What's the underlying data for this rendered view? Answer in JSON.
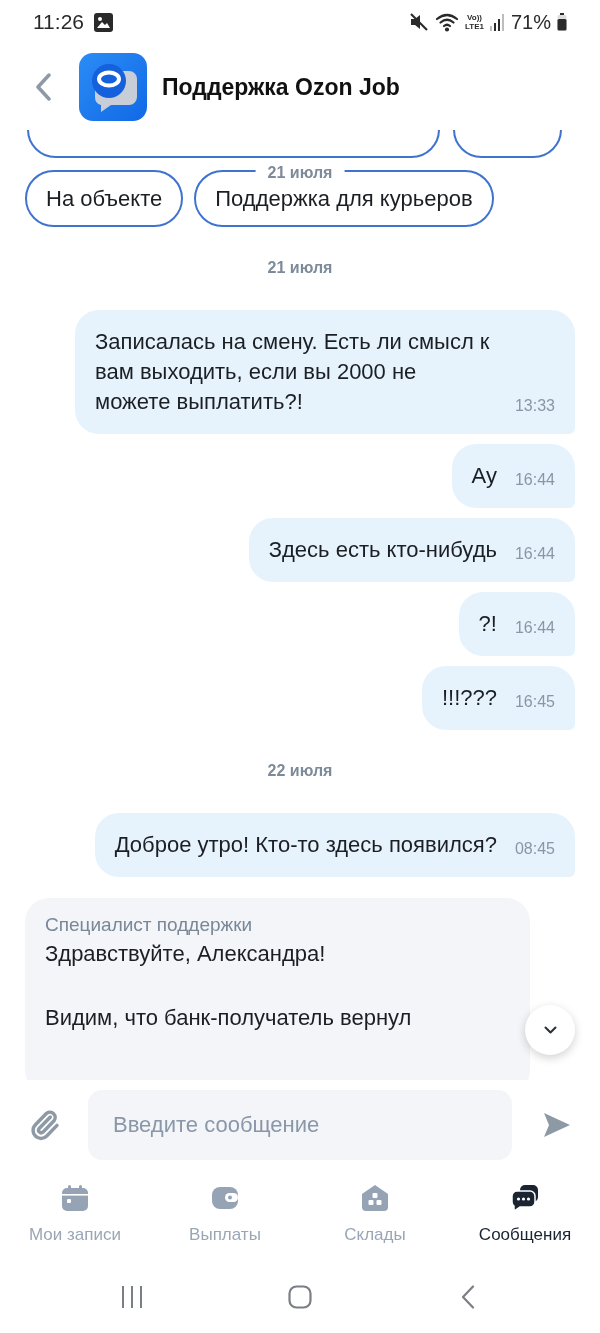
{
  "status_bar": {
    "time": "11:26",
    "network": [
      "Vo))",
      "LTE1"
    ],
    "battery": "71%"
  },
  "header": {
    "title": "Поддержка Ozon Job"
  },
  "chat": {
    "sticky_date": "21 июля",
    "clipped_chips": [
      {
        "kind": "chip"
      },
      {
        "kind": "chip"
      }
    ],
    "quick_replies": [
      {
        "label": "На объекте"
      },
      {
        "label": "Поддержка для курьеров"
      }
    ],
    "messages": [
      {
        "kind": "date",
        "text": "21 июля"
      },
      {
        "kind": "outgoing",
        "text": "Записалась на смену. Есть ли смысл к вам выходить, если вы 2000 не можете выплатить?!",
        "time": "13:33"
      },
      {
        "kind": "outgoing",
        "text": "Ау",
        "time": "16:44"
      },
      {
        "kind": "outgoing",
        "text": "Здесь есть кто-нибудь",
        "time": "16:44"
      },
      {
        "kind": "outgoing",
        "text": "?!",
        "time": "16:44"
      },
      {
        "kind": "outgoing",
        "text": "!!!???",
        "time": "16:45"
      },
      {
        "kind": "date",
        "text": "22 июля"
      },
      {
        "kind": "outgoing",
        "text": "Доброе утро! Кто-то здесь появился?",
        "time": "08:45"
      },
      {
        "kind": "incoming",
        "sender": "Специалист поддержки",
        "paragraphs": [
          "Здравствуйте, Александра!",
          "Видим, что банк-получатель вернул"
        ]
      }
    ]
  },
  "composer": {
    "placeholder": "Введите сообщение"
  },
  "tabs": [
    {
      "label": "Мои записи",
      "selected": false
    },
    {
      "label": "Выплаты",
      "selected": false
    },
    {
      "label": "Склады",
      "selected": false
    },
    {
      "label": "Сообщения",
      "selected": true
    }
  ]
}
